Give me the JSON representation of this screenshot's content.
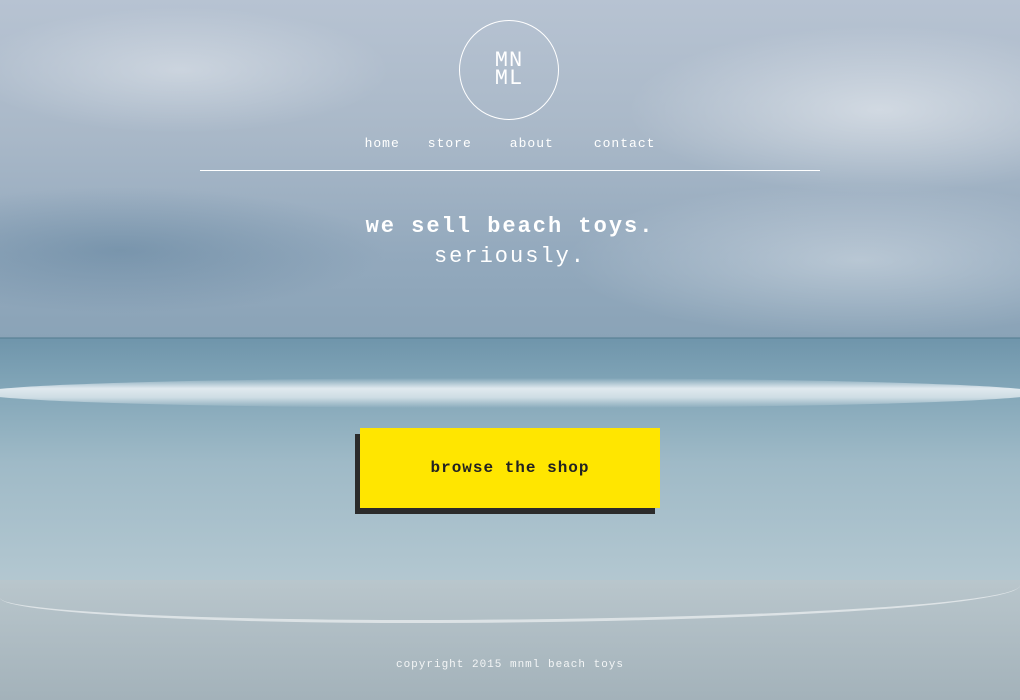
{
  "brand": {
    "logo_line1": "MN",
    "logo_line2": "ML"
  },
  "nav": {
    "items": [
      {
        "label": "home"
      },
      {
        "label": "store"
      },
      {
        "label": "about"
      },
      {
        "label": "contact"
      }
    ]
  },
  "hero": {
    "headline": "we sell beach toys.",
    "subline": "seriously."
  },
  "cta": {
    "label": "browse the shop"
  },
  "footer": {
    "copyright": "copyright 2015 mnml beach toys"
  },
  "colors": {
    "cta_background": "#ffe600",
    "cta_shadow": "#2b2b2b",
    "text": "#ffffff"
  }
}
